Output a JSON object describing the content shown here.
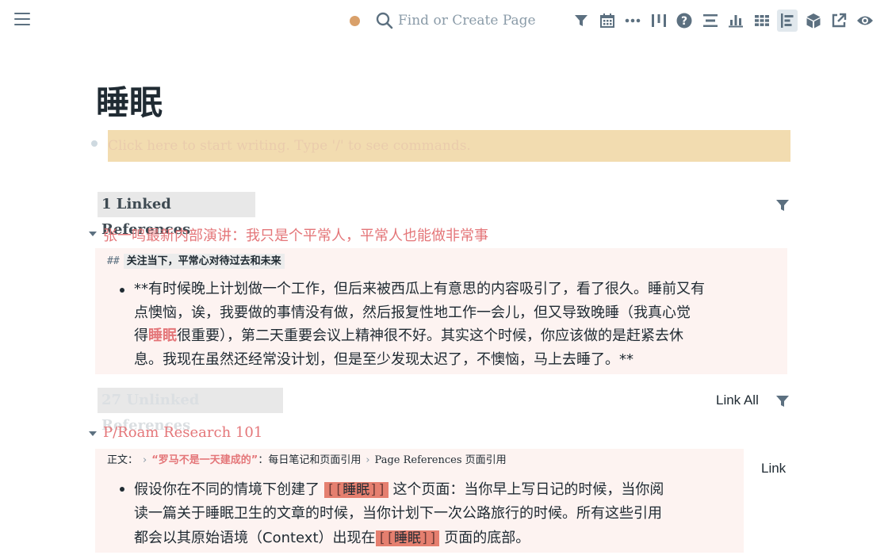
{
  "topbar": {
    "search_placeholder": "Find or Create Page",
    "sync_color": "#d9a06a",
    "icons": [
      "filter-icon",
      "calendar-icon",
      "more-icon",
      "columns-icon",
      "help-icon",
      "align-icon",
      "bar-chart-icon",
      "table-icon",
      "sidebar-icon",
      "cube-icon",
      "external-link-icon",
      "eye-icon"
    ]
  },
  "page": {
    "title": "睡眠",
    "first_block_placeholder": "Click here to start writing. Type '/' to see commands."
  },
  "linked": {
    "header": "1 Linked References",
    "page_title": "张一鸣最新内部演讲：我只是个平常人，平常人也能做非常事",
    "breadcrumb_hash": "##",
    "breadcrumb_text": "关注当下，平常心对待过去和未来",
    "block_lines": [
      "**有时候晚上计划做一个工作，但后来被西瓜上有意思的内容吸引了，看了很久。睡前又有",
      "点懊恼，诶，我要做的事情没有做，然后报复性地工作一会儿，但又导致晚睡（我真心觉",
      "很重要），第二天重要会议上精神很不好。其实这个时候，你应该做的是赶紧去休",
      "息。我现在虽然还经常没计划，但是至少发现太迟了，不懊恼，马上去睡了。**"
    ],
    "line3_prefix": "得",
    "highlight_word": "睡眠"
  },
  "unlinked": {
    "header": "27 Unlinked References",
    "link_all_label": "Link All",
    "page_title": "P/Roam Research 101",
    "breadcrumb_label": "正文：",
    "breadcrumb_red": "“罗马不是一天建成的”",
    "breadcrumb_colon": "：每日笔记和页面引用",
    "breadcrumb_last": "Page References 页面引用",
    "link_label": "Link",
    "line1_before": "假设你在不同的情境下创建了",
    "line1_after": "这个页面：当你早上写日记的时候，当你阅",
    "line2": "读一篇关于睡眠卫生的文章的时候，当你计划下一次公路旅行的时候。所有这些引用",
    "line3_before": "都会以其原始语境（Context）出现在",
    "line3_after": "页面的底部。",
    "ref_word": "睡眠",
    "bracket_open": "[[",
    "bracket_close": "]]"
  }
}
